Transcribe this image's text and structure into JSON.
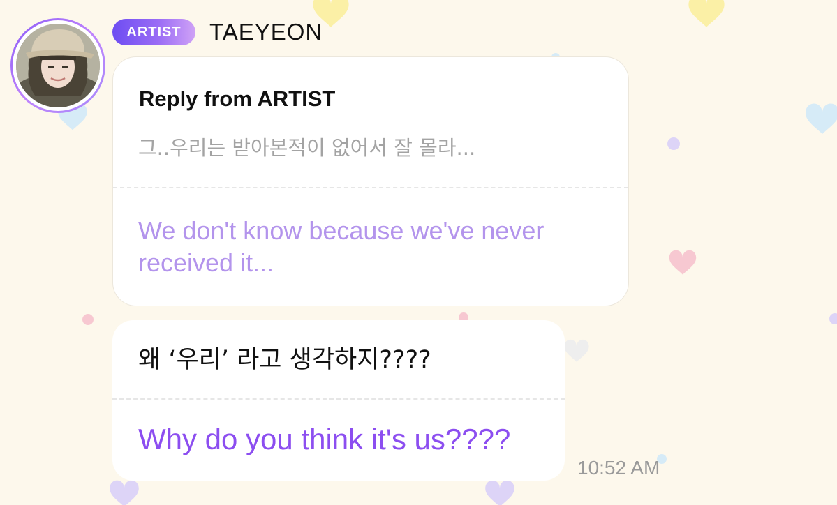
{
  "header": {
    "badge_label": "ARTIST",
    "artist_name": "TAEYEON",
    "avatar_icon": "artist-avatar-photo"
  },
  "reply_message": {
    "title": "Reply from ARTIST",
    "original_text": "그..우리는 받아본적이 없어서 잘 몰라...",
    "translation": "We don't know because we've never received it..."
  },
  "message": {
    "original_text": "왜 ‘우리’ 라고 생각하지????",
    "translation": "Why do you think it's us????",
    "timestamp": "10:52 AM"
  },
  "colors": {
    "background": "#fdf8ec",
    "badge_gradient_start": "#6d4df2",
    "badge_gradient_end": "#cfa2f6",
    "translation_light": "#b394ec",
    "translation_dark": "#8c4ef0",
    "reply_original": "#a3a3a3"
  }
}
